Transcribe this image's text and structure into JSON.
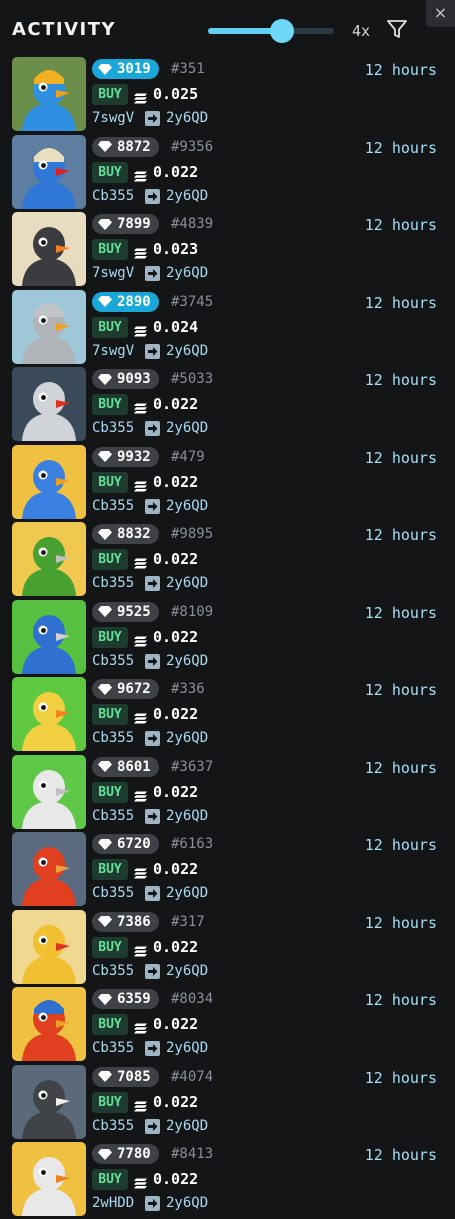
{
  "header": {
    "title": "ACTIVITY",
    "speed_label": "4x",
    "speed_slider_value_percent": 59,
    "close_label": "×"
  },
  "colors": {
    "accent": "#5fd0f0",
    "rank_top": "#18a7d7",
    "rank_default": "#3e4246",
    "buy_bg": "#1d3b2e",
    "buy_text": "#62e095",
    "time_text": "#a9def5"
  },
  "icons": {
    "filter": "filter-icon",
    "close": "close-icon",
    "rank": "gem-icon",
    "currency": "sol-icon",
    "transfer": "arrow-right-icon"
  },
  "activity": [
    {
      "rank": "3019",
      "rank_top": true,
      "token_id": "#351",
      "action": "BUY",
      "price": "0.025",
      "from": "7swgV",
      "to": "2y6QD",
      "time": "12 hours",
      "bg": "#6b8f4a",
      "body": "#2f8fe0",
      "beak": "#f0a020",
      "hat": "#f0b020"
    },
    {
      "rank": "8872",
      "rank_top": false,
      "token_id": "#9356",
      "action": "BUY",
      "price": "0.022",
      "from": "Cb355",
      "to": "2y6QD",
      "time": "12 hours",
      "bg": "#5d7ea0",
      "body": "#2f78d8",
      "beak": "#e02020",
      "hat": "#e8e0c0"
    },
    {
      "rank": "7899",
      "rank_top": false,
      "token_id": "#4839",
      "action": "BUY",
      "price": "0.023",
      "from": "7swgV",
      "to": "2y6QD",
      "time": "12 hours",
      "bg": "#e8dcc0",
      "body": "#3a3c40",
      "beak": "#f08020",
      "hat": ""
    },
    {
      "rank": "2890",
      "rank_top": true,
      "token_id": "#3745",
      "action": "BUY",
      "price": "0.024",
      "from": "7swgV",
      "to": "2y6QD",
      "time": "12 hours",
      "bg": "#9ec8d8",
      "body": "#b0b4b8",
      "beak": "#f0a020",
      "hat": "#c0c4c8"
    },
    {
      "rank": "9093",
      "rank_top": false,
      "token_id": "#5033",
      "action": "BUY",
      "price": "0.022",
      "from": "Cb355",
      "to": "2y6QD",
      "time": "12 hours",
      "bg": "#3a4a5a",
      "body": "#d0d4d8",
      "beak": "#e03020",
      "hat": ""
    },
    {
      "rank": "9932",
      "rank_top": false,
      "token_id": "#479",
      "action": "BUY",
      "price": "0.022",
      "from": "Cb355",
      "to": "2y6QD",
      "time": "12 hours",
      "bg": "#f0c040",
      "body": "#3a80e0",
      "beak": "#f0a020",
      "hat": ""
    },
    {
      "rank": "8832",
      "rank_top": false,
      "token_id": "#9895",
      "action": "BUY",
      "price": "0.022",
      "from": "Cb355",
      "to": "2y6QD",
      "time": "12 hours",
      "bg": "#f0c850",
      "body": "#48a030",
      "beak": "#c0c0c0",
      "hat": ""
    },
    {
      "rank": "9525",
      "rank_top": false,
      "token_id": "#8109",
      "action": "BUY",
      "price": "0.022",
      "from": "Cb355",
      "to": "2y6QD",
      "time": "12 hours",
      "bg": "#58c040",
      "body": "#2f70d0",
      "beak": "#d0d0d0",
      "hat": ""
    },
    {
      "rank": "9672",
      "rank_top": false,
      "token_id": "#336",
      "action": "BUY",
      "price": "0.022",
      "from": "Cb355",
      "to": "2y6QD",
      "time": "12 hours",
      "bg": "#60c840",
      "body": "#f0d040",
      "beak": "#f08020",
      "hat": ""
    },
    {
      "rank": "8601",
      "rank_top": false,
      "token_id": "#3637",
      "action": "BUY",
      "price": "0.022",
      "from": "Cb355",
      "to": "2y6QD",
      "time": "12 hours",
      "bg": "#60c848",
      "body": "#e8e8e8",
      "beak": "#c0c0c0",
      "hat": ""
    },
    {
      "rank": "6720",
      "rank_top": false,
      "token_id": "#6163",
      "action": "BUY",
      "price": "0.022",
      "from": "Cb355",
      "to": "2y6QD",
      "time": "12 hours",
      "bg": "#5a6a80",
      "body": "#e04020",
      "beak": "#f0a040",
      "hat": ""
    },
    {
      "rank": "7386",
      "rank_top": false,
      "token_id": "#317",
      "action": "BUY",
      "price": "0.022",
      "from": "Cb355",
      "to": "2y6QD",
      "time": "12 hours",
      "bg": "#f0d890",
      "body": "#f0c030",
      "beak": "#e03020",
      "hat": ""
    },
    {
      "rank": "6359",
      "rank_top": false,
      "token_id": "#8034",
      "action": "BUY",
      "price": "0.022",
      "from": "Cb355",
      "to": "2y6QD",
      "time": "12 hours",
      "bg": "#f0c040",
      "body": "#e04020",
      "beak": "#f0a020",
      "hat": "#2f70d0"
    },
    {
      "rank": "7085",
      "rank_top": false,
      "token_id": "#4074",
      "action": "BUY",
      "price": "0.022",
      "from": "Cb355",
      "to": "2y6QD",
      "time": "12 hours",
      "bg": "#5a6a7a",
      "body": "#404448",
      "beak": "#f0f0f0",
      "hat": ""
    },
    {
      "rank": "7780",
      "rank_top": false,
      "token_id": "#8413",
      "action": "BUY",
      "price": "0.022",
      "from": "2wHDD",
      "to": "2y6QD",
      "time": "12 hours",
      "bg": "#f0c040",
      "body": "#e8e8e8",
      "beak": "#f08020",
      "hat": ""
    }
  ]
}
